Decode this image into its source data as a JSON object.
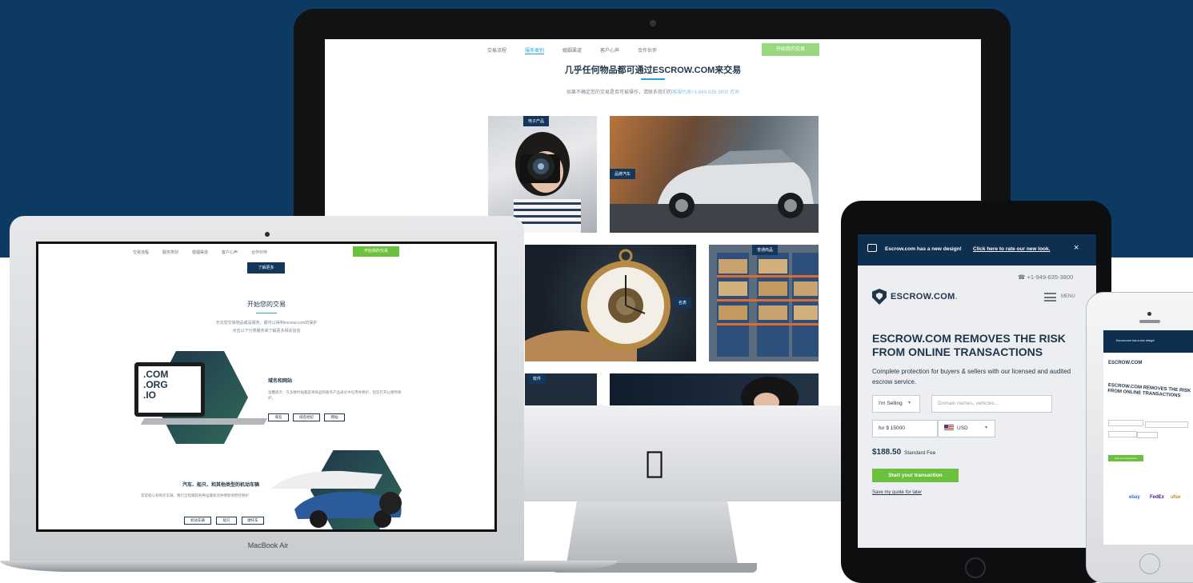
{
  "imac": {
    "nav": [
      "交易流程",
      "服务类别",
      "婚姻渠道",
      "客户心声",
      "合作伙伴"
    ],
    "nav_cta": "开始我的交易",
    "heading": "几乎任何物品都可通过ESCROW.COM来交易",
    "subheading": "如果不确定您的交易是否可被操作，请联系我们的",
    "subheading_link": "客服代表+1-949-635-3800 咨询",
    "tiles": [
      {
        "tag": "电子产品"
      },
      {
        "tag": "品牌汽车"
      },
      {
        "tag": "名表"
      },
      {
        "tag": "普通商品"
      },
      {
        "tag": "软件"
      }
    ],
    "apple_logo": "apple-logo"
  },
  "macbook": {
    "label": "MacBook Air",
    "nav": [
      "交易流程",
      "服务类别",
      "婚姻渠道",
      "客户心声",
      "合作伙伴"
    ],
    "nav_cta": "开始我的交易",
    "learn_more": "了解更多",
    "heading": "开始您的交易",
    "sub_1": "无论您交易物品或是服务，都可以得到escrow.com的保护",
    "sub_2": "点击以下分类服务来了解更多相关信息",
    "domains_badge": [
      ".COM",
      ".ORG",
      ".IO"
    ],
    "section1": {
      "title": "域名和网站",
      "text": "温馨提示：在多数时候都是将商品和服务产品采买中信用并保护，但在打开以便所保护。",
      "buttons": [
        "域名",
        "域名经纪",
        "网站"
      ]
    },
    "section2": {
      "title": "汽车、船只、和其他类型的机动车辆",
      "text": "常常担心有购买车辆，我们全程跟踪各种运输状况并明智地把控保护",
      "buttons": [
        "机动车辆",
        "船只",
        "摩托车"
      ]
    }
  },
  "ipad": {
    "banner_text": "Escrow.com has a new design!",
    "banner_link": "Click here to rate our new look.",
    "close": "×",
    "phone": "+1-949-635-3800",
    "logo": "ESCROW.COM",
    "logo_dot": ".",
    "menu_label": "MENU",
    "headline": "ESCROW.COM REMOVES THE RISK FROM ONLINE TRANSACTIONS",
    "description": "Complete protection for buyers & sellers with our licensed and audited escrow service.",
    "role_select": "I'm Selling",
    "item_placeholder": "Domain names, vehicles...",
    "amount": "for $ 15000",
    "currency": "USD",
    "fee": "$188.50",
    "fee_label": "Standard Fee",
    "cta": "Start your transaction",
    "save_link": "Save my quote for later"
  },
  "iphone": {
    "banner_text": "Escrow.com has a new design!",
    "logo": "ESCROW.COM",
    "headline": "ESCROW.COM REMOVES THE RISK FROM ONLINE TRANSACTIONS",
    "cta": "Start your transaction",
    "brands": [
      "ebay",
      "FedEx",
      "ufse"
    ]
  },
  "colors": {
    "background_navy": "#0c3a63",
    "brand_navy": "#1f3549",
    "accent_green": "#6bc13d",
    "accent_blue": "#2aa0d6"
  }
}
